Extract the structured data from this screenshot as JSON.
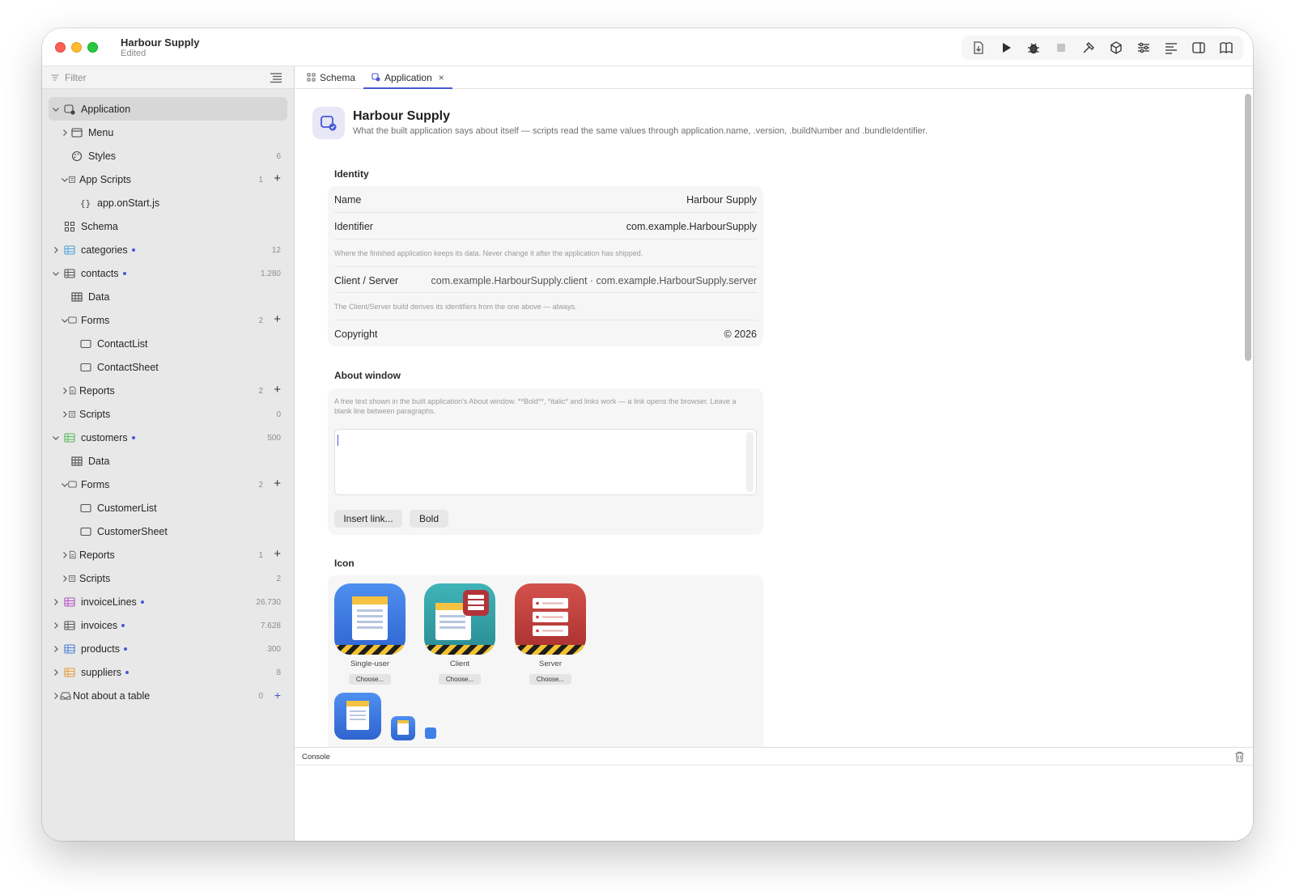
{
  "window": {
    "title": "Harbour Supply",
    "subtitle": "Edited"
  },
  "toolbar": {
    "buttons": [
      "export-icon",
      "run-icon",
      "debug-icon",
      "stop-icon",
      "build-icon",
      "package-icon",
      "settings-sliders-icon",
      "align-left-icon",
      "sidebar-toggle-icon",
      "book-icon"
    ]
  },
  "sidebar": {
    "filter_placeholder": "Filter",
    "items": [
      {
        "label": "Application",
        "level": 0,
        "icon": "application-icon",
        "chevron": "down",
        "selected": true
      },
      {
        "label": "Menu",
        "level": 1,
        "icon": "menu-window-icon",
        "chevron": "right"
      },
      {
        "label": "Styles",
        "level": 1,
        "icon": "palette-icon",
        "count": "6"
      },
      {
        "label": "App Scripts",
        "level": 1,
        "icon": "scripts-icon",
        "chevron": "down",
        "count": "1",
        "plus": true
      },
      {
        "label": "app.onStart.js",
        "level": 2,
        "icon": "braces-icon"
      },
      {
        "label": "Schema",
        "level": 0,
        "icon": "schema-icon"
      },
      {
        "label": "categories",
        "level": 0,
        "icon": "table-icon",
        "chevron": "right",
        "count": "12",
        "dot": true,
        "color": "#4fa3d6"
      },
      {
        "label": "contacts",
        "level": 0,
        "icon": "table-icon",
        "chevron": "down",
        "count": "1.280",
        "dot": true,
        "color": "#555555"
      },
      {
        "label": "Data",
        "level": 1,
        "icon": "grid-icon"
      },
      {
        "label": "Forms",
        "level": 1,
        "icon": "form-icon",
        "chevron": "down",
        "count": "2",
        "plus": true
      },
      {
        "label": "ContactList",
        "level": 2,
        "icon": "form-icon"
      },
      {
        "label": "ContactSheet",
        "level": 2,
        "icon": "form-icon"
      },
      {
        "label": "Reports",
        "level": 1,
        "icon": "report-icon",
        "chevron": "right",
        "count": "2",
        "plus": true
      },
      {
        "label": "Scripts",
        "level": 1,
        "icon": "scripts-icon",
        "chevron": "right",
        "count": "0"
      },
      {
        "label": "customers",
        "level": 0,
        "icon": "table-icon",
        "chevron": "down",
        "count": "500",
        "dot": true,
        "color": "#5cb85c"
      },
      {
        "label": "Data",
        "level": 1,
        "icon": "grid-icon"
      },
      {
        "label": "Forms",
        "level": 1,
        "icon": "form-icon",
        "chevron": "down",
        "count": "2",
        "plus": true
      },
      {
        "label": "CustomerList",
        "level": 2,
        "icon": "form-icon"
      },
      {
        "label": "CustomerSheet",
        "level": 2,
        "icon": "form-icon"
      },
      {
        "label": "Reports",
        "level": 1,
        "icon": "report-icon",
        "chevron": "right",
        "count": "1",
        "plus": true
      },
      {
        "label": "Scripts",
        "level": 1,
        "icon": "scripts-icon",
        "chevron": "right",
        "count": "2"
      },
      {
        "label": "invoiceLines",
        "level": 0,
        "icon": "table-icon",
        "chevron": "right",
        "count": "26.730",
        "dot": true,
        "color": "#b14fc6"
      },
      {
        "label": "invoices",
        "level": 0,
        "icon": "table-icon",
        "chevron": "right",
        "count": "7.628",
        "dot": true,
        "color": "#555555"
      },
      {
        "label": "products",
        "level": 0,
        "icon": "table-icon",
        "chevron": "right",
        "count": "300",
        "dot": true,
        "color": "#4a7fd6"
      },
      {
        "label": "suppliers",
        "level": 0,
        "icon": "table-icon",
        "chevron": "right",
        "count": "8",
        "dot": true,
        "color": "#e69a3a"
      },
      {
        "label": "Not about a table",
        "level": 0,
        "icon": "tray-icon",
        "chevron": "right",
        "count": "0",
        "plus_small": true,
        "compact": true
      }
    ]
  },
  "tabs": [
    {
      "label": "Schema",
      "icon": "schema-icon",
      "active": false
    },
    {
      "label": "Application",
      "icon": "application-icon",
      "active": true,
      "close": "×"
    }
  ],
  "header": {
    "title": "Harbour Supply",
    "description": "What the built application says about itself — scripts read the same values through application.name, .version, .buildNumber and .bundleIdentifier."
  },
  "identity": {
    "section": "Identity",
    "name_label": "Name",
    "name_value": "Harbour Supply",
    "identifier_label": "Identifier",
    "identifier_value": "com.example.HarbourSupply",
    "identifier_note": "Where the finished application keeps its data. Never change it after the application has shipped.",
    "cs_label": "Client / Server",
    "cs_value": "com.example.HarbourSupply.client · com.example.HarbourSupply.server",
    "cs_note": "The Client/Server build derives its identifiers from the one above — always.",
    "copyright_label": "Copyright",
    "copyright_value": "© 2026"
  },
  "about": {
    "section": "About window",
    "help": "A free text shown in the built application's About window. **Bold**, *italic* and links work — a link opens the browser. Leave a blank line between paragraphs.",
    "text_value": "",
    "insert_link": "Insert link...",
    "bold": "Bold"
  },
  "icon_section": {
    "section": "Icon",
    "icons": [
      {
        "label": "Single-user",
        "choose": "Choose..."
      },
      {
        "label": "Client",
        "choose": "Choose..."
      },
      {
        "label": "Server",
        "choose": "Choose..."
      }
    ]
  },
  "console": {
    "title": "Console"
  },
  "colors": {
    "accent": "#4758d4",
    "sidebar_bg": "#e8e8e8"
  }
}
